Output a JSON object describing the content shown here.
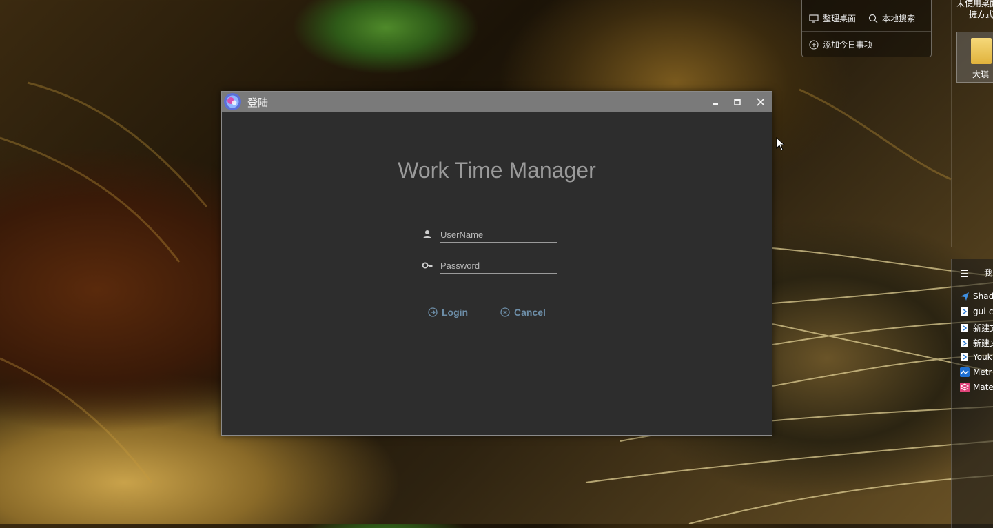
{
  "desktop": {
    "widget": {
      "tidy_desktop": "整理桌面",
      "local_search": "本地搜索",
      "add_today_item": "添加今日事项",
      "icons": [
        "monitor-icon",
        "search-icon",
        "plus-circle-icon"
      ]
    },
    "edge_labels": {
      "top_line1": "未使用桌面",
      "top_line2": "捷方式"
    },
    "folder_tile": {
      "label": "大琪"
    },
    "side_panel": {
      "title": "我",
      "items": [
        {
          "label": "Shad",
          "icon": "paper-plane-icon",
          "color": "#3f8fe0"
        },
        {
          "label": "gui-c",
          "icon": "vscode-file-icon",
          "color": "#2a7ad3"
        },
        {
          "label": "新建文",
          "icon": "vscode-file-icon",
          "color": "#2a7ad3"
        },
        {
          "label": "新建文",
          "icon": "vscode-file-icon",
          "color": "#2a7ad3"
        },
        {
          "label": "Youk",
          "icon": "vscode-file-icon",
          "color": "#2a7ad3"
        },
        {
          "label": "Metr",
          "icon": "metro-icon",
          "color": "#1e6fd0"
        },
        {
          "label": "Mate",
          "icon": "material-stack-icon",
          "color": "#e0447a"
        }
      ]
    }
  },
  "window": {
    "title": "登陆",
    "app_title": "Work Time Manager",
    "username": {
      "value": "",
      "placeholder": "UserName",
      "icon": "person-icon"
    },
    "password": {
      "value": "",
      "placeholder": "Password",
      "icon": "key-icon"
    },
    "buttons": {
      "login": "Login",
      "cancel": "Cancel"
    },
    "controls": {
      "minimize": "▁",
      "maximize": "▫",
      "close": "✕"
    },
    "colors": {
      "titlebar": "#7a7a7a",
      "body": "#2d2d2d",
      "accent": "#6d8ea8"
    }
  }
}
